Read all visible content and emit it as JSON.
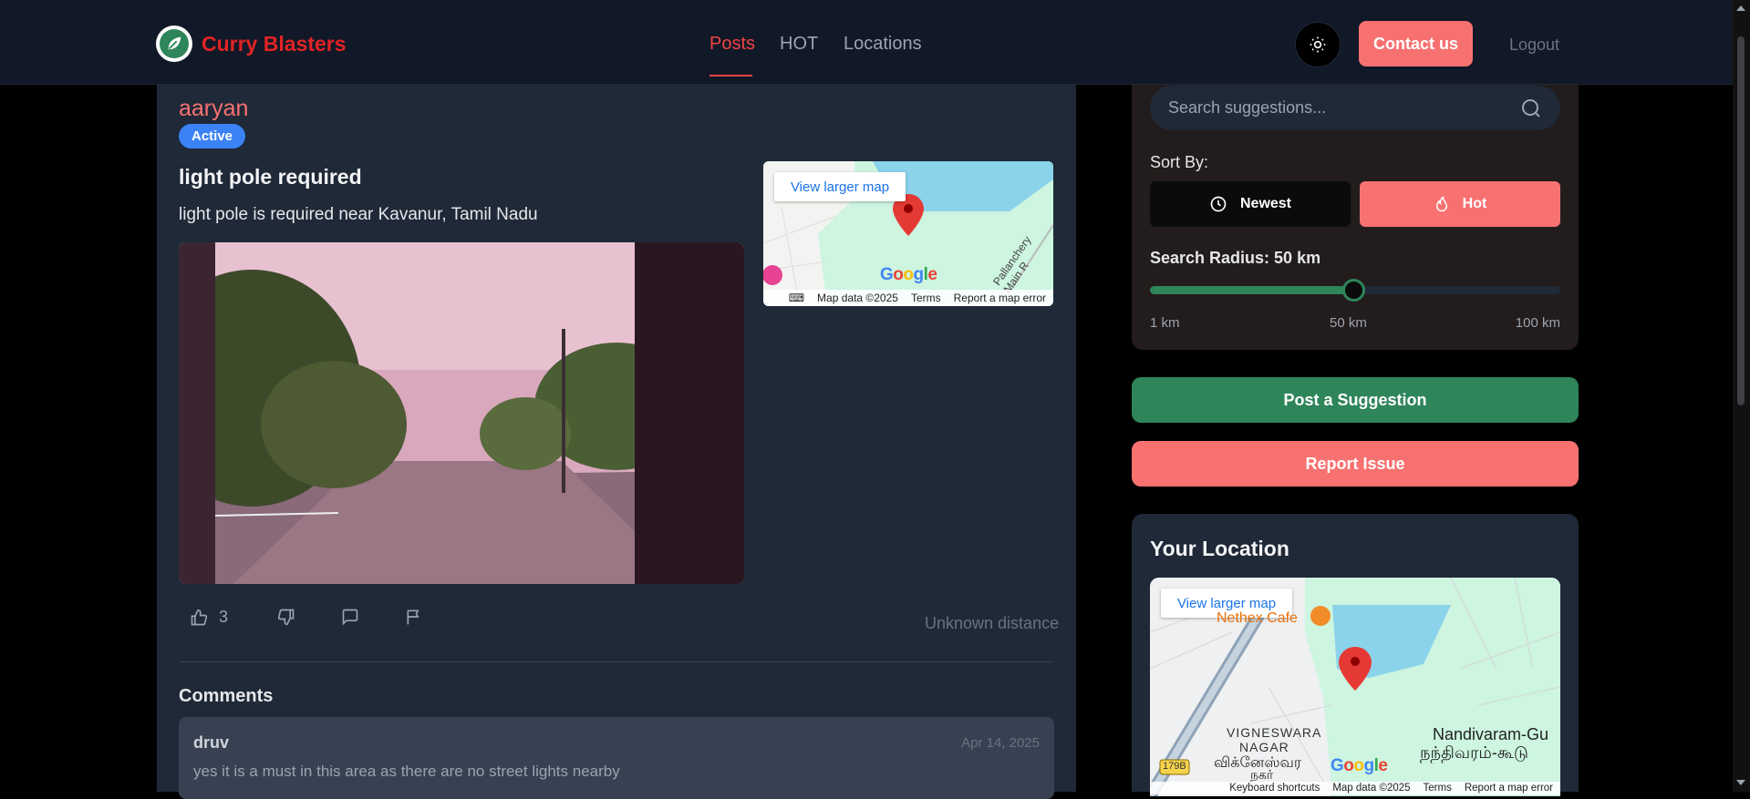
{
  "header": {
    "brand": "Curry Blasters",
    "nav": [
      "Posts",
      "HOT",
      "Locations"
    ],
    "active_nav": "Posts",
    "contact_label": "Contact us",
    "logout_label": "Logout"
  },
  "post": {
    "author": "aaryan",
    "status": "Active",
    "title": "light pole required",
    "description": "light pole is required near Kavanur, Tamil Nadu",
    "likes": "3",
    "distance": "Unknown distance",
    "map": {
      "view_larger": "View larger map",
      "footer": [
        "Map data ©2025",
        "Terms",
        "Report a map error"
      ],
      "road_label": "Pallanchery Main R"
    }
  },
  "comments": {
    "title": "Comments",
    "items": [
      {
        "author": "druv",
        "date": "Apr 14, 2025",
        "text": "yes it is a must in this area as there are no street lights nearby"
      }
    ]
  },
  "filters": {
    "search_placeholder": "Search suggestions...",
    "sort_label": "Sort By:",
    "sort_newest": "Newest",
    "sort_hot": "Hot",
    "radius_label": "Search Radius: 50 km",
    "radius_value": 50,
    "radius_min": 1,
    "radius_max": 100,
    "ticks": [
      "1 km",
      "50 km",
      "100 km"
    ]
  },
  "buttons": {
    "post_suggestion": "Post a Suggestion",
    "report_issue": "Report Issue"
  },
  "location": {
    "title": "Your Location",
    "map": {
      "view_larger": "View larger map",
      "labels": [
        "Nethex Cafe",
        "VIGNESWARA",
        "NAGAR",
        "விக்னேஸ்வர",
        "நகர்",
        "Nandivaram-Gu",
        "நந்திவரம்-கூடு",
        "179B"
      ],
      "footer": [
        "Keyboard shortcuts",
        "Map data ©2025",
        "Terms",
        "Report a map error"
      ]
    }
  },
  "colors": {
    "brand": "#e02424",
    "accent": "#f87171",
    "green": "#2f855a",
    "badge": "#3b82f6"
  }
}
